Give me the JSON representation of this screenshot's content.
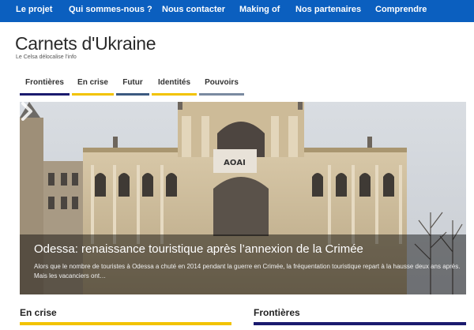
{
  "nav": {
    "items": [
      {
        "label": "Le projet"
      },
      {
        "label": "Qui sommes-nous ?"
      },
      {
        "label": "Nous contacter"
      },
      {
        "label": "Making of"
      },
      {
        "label": "Nos partenaires"
      },
      {
        "label": "Comprendre"
      }
    ]
  },
  "site": {
    "title": "Carnets d'Ukraine",
    "tagline": "Le Celsa délocalise l'info"
  },
  "categories": [
    {
      "label": "Frontières",
      "color": "#1a1a6e"
    },
    {
      "label": "En crise",
      "color": "#f2c300"
    },
    {
      "label": "Futur",
      "color": "#3c5a80"
    },
    {
      "label": "Identités",
      "color": "#f2c300"
    },
    {
      "label": "Pouvoirs",
      "color": "#7a8aa0"
    }
  ],
  "hero": {
    "title": "Odessa: renaissance touristique après l’annexion de la Crimée",
    "excerpt": "Alors que le nombre de touristes à Odessa a chuté en 2014 pendant la guerre en Crimée, la fréquentation touristique repart à la hausse deux ans après. Mais les vacanciers ont…",
    "banner_text": "АОАI"
  },
  "sections": [
    {
      "title": "En crise",
      "color": "#f2c300"
    },
    {
      "title": "Frontières",
      "color": "#1a1a6e"
    }
  ],
  "colors": {
    "nav_bg": "#0b5fbf",
    "accent_navy": "#1a1a6e",
    "accent_yellow": "#f2c300"
  }
}
